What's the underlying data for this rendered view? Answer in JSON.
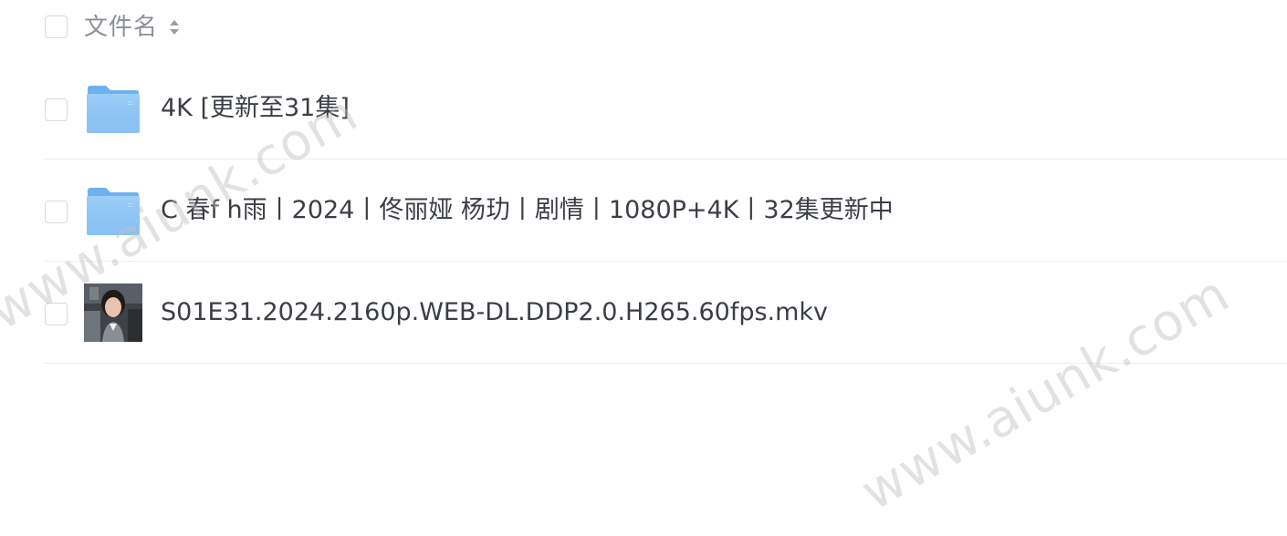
{
  "header": {
    "column_label": "文件名"
  },
  "files": [
    {
      "name": "4K [更新至31集]",
      "type": "folder"
    },
    {
      "name": "C 春f h雨丨2024丨佟丽娅 杨玏丨剧情丨1080P+4K丨32集更新中",
      "type": "folder"
    },
    {
      "name": "S01E31.2024.2160p.WEB-DL.DDP2.0.H265.60fps.mkv",
      "type": "video"
    }
  ],
  "watermark_text": "www.aiunk.com",
  "colors": {
    "folder": "#8fc6f5",
    "text": "#3b3e45",
    "header_text": "#8c8f96",
    "divider": "#eceef2"
  },
  "icons": {
    "folder": "folder-icon",
    "sort": "sort-icon",
    "thumbnail": "video-thumbnail"
  }
}
